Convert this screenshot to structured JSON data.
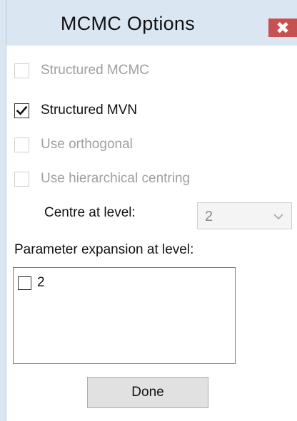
{
  "window": {
    "title": "MCMC Options",
    "close_icon": "close-icon"
  },
  "options": [
    {
      "label": "Structured MCMC",
      "checked": false,
      "enabled": false
    },
    {
      "label": "Structured MVN",
      "checked": true,
      "enabled": true
    },
    {
      "label": "Use orthogonal",
      "checked": false,
      "enabled": false
    },
    {
      "label": "Use hierarchical centring",
      "checked": false,
      "enabled": false
    }
  ],
  "centre": {
    "label": "Centre at level:",
    "value": "2",
    "enabled": false
  },
  "param_expansion": {
    "label": "Parameter expansion at level:",
    "items": [
      {
        "label": "2",
        "checked": false
      }
    ]
  },
  "done_label": "Done",
  "colors": {
    "titlebar": "#dbe6f3",
    "close_button": "#c75050",
    "disabled_text": "#9f9f9f"
  }
}
